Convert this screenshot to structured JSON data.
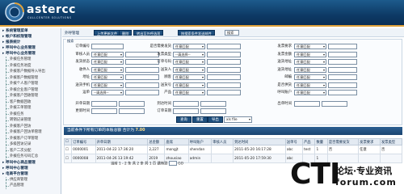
{
  "brand": {
    "name": "astercc",
    "tagline": "CALLCENTER SOLUTIONS"
  },
  "sidebar": {
    "items": [
      {
        "kind": "group",
        "label": "系统管理菜单"
      },
      {
        "kind": "group",
        "label": "帐户和权限管理"
      },
      {
        "kind": "group",
        "label": "报表统计"
      },
      {
        "kind": "group",
        "label": "呼叫中心业务管理"
      },
      {
        "kind": "group",
        "label": "呼叫中心业务管理"
      },
      {
        "kind": "sub",
        "label": "外拨任务管理"
      },
      {
        "kind": "sub",
        "label": "外拨任务进度"
      },
      {
        "kind": "sub",
        "label": "外拨客户数据导入导出"
      },
      {
        "kind": "sub",
        "label": "外拨客户数据管理"
      },
      {
        "kind": "sub",
        "label": "外拨个人客户管理"
      },
      {
        "kind": "sub",
        "label": "外拨企业客户管理"
      },
      {
        "kind": "sub",
        "label": "外拨客户回收管理"
      },
      {
        "kind": "sub",
        "label": "客户数据回收"
      },
      {
        "kind": "sub",
        "label": "外拨工单管理"
      },
      {
        "kind": "sub",
        "label": "外拨任务"
      },
      {
        "kind": "sub",
        "label": "转销记录管理"
      },
      {
        "kind": "sub",
        "label": "外拨客户回访"
      },
      {
        "kind": "sub",
        "label": "外拨客户回访单管理"
      },
      {
        "kind": "sub",
        "label": "外拨客户订单管理"
      },
      {
        "kind": "sub",
        "label": "多级回访记录"
      },
      {
        "kind": "sub",
        "label": "客户二次分配"
      },
      {
        "kind": "sub",
        "label": "外拨任务号码汇总"
      },
      {
        "kind": "group",
        "label": "呼叫中心商品管理"
      },
      {
        "kind": "group",
        "label": "呼叫中心管理"
      },
      {
        "kind": "group",
        "label": "电商平台管理"
      },
      {
        "kind": "sub",
        "label": "供应商管理"
      },
      {
        "kind": "sub",
        "label": "产品管理"
      }
    ]
  },
  "toolbar": {
    "title": "外呼管理",
    "buttons": [
      "上传更新文件",
      "删除",
      "转出至外呼选项",
      "按搜索条件发送邮件"
    ],
    "select_value": "搜索"
  },
  "search": {
    "legend": "搜索",
    "rows": [
      [
        {
          "label": "订单编号",
          "type": "input",
          "value": ""
        },
        {
          "label": "是否需要发货",
          "type": "select",
          "value": "任意匹配"
        },
        {
          "label": "发票要求",
          "type": "select",
          "value": "任意匹配"
        }
      ],
      [
        {
          "label": "审核人员",
          "type": "select",
          "value": "任意匹配"
        },
        {
          "label": "发票类型",
          "type": "select",
          "value": "--请选择--"
        },
        {
          "label": "发票金额",
          "type": "select",
          "value": "任意匹配"
        }
      ],
      [
        {
          "label": "发货状态",
          "type": "select",
          "value": "任意匹配"
        },
        {
          "label": "订单号码",
          "type": "select",
          "value": "任意匹配"
        },
        {
          "label": "送货地址",
          "type": "select",
          "value": "任意匹配"
        }
      ],
      [
        {
          "label": "收件人",
          "type": "select",
          "value": "任意匹配"
        },
        {
          "label": "送货人",
          "type": "select",
          "value": "任意匹配"
        },
        {
          "label": "送货地址",
          "type": "select",
          "value": "任意匹配"
        }
      ],
      [
        {
          "label": "地址",
          "type": "select",
          "value": "任意匹配"
        },
        {
          "label": "顾客",
          "type": "select",
          "value": "任意匹配"
        },
        {
          "label": "邮编",
          "type": "select",
          "value": "任意匹配"
        }
      ],
      [
        {
          "label": "送货手机",
          "type": "select",
          "value": "任意匹配"
        },
        {
          "label": "送货号",
          "type": "select",
          "value": "任意匹配"
        },
        {
          "label": "是否供货",
          "type": "select",
          "value": "任意匹配"
        }
      ],
      [
        {
          "label": "运单",
          "type": "select",
          "value": "--请选择--"
        },
        {
          "label": "产品",
          "type": "select",
          "value": "任意匹配"
        },
        {
          "label": "呼叫账户",
          "type": "select",
          "value": "任意匹配"
        }
      ]
    ],
    "date_rows": [
      [
        {
          "label": "开单日期"
        },
        {
          "label": "到达时间"
        },
        {
          "label": "出单时间"
        }
      ],
      [
        {
          "label": "更新时间"
        },
        {
          "label": "订单日期"
        },
        {
          "label": ""
        }
      ]
    ],
    "actions": [
      "查询",
      "重置",
      "导出"
    ],
    "export_select": "xls file"
  },
  "summary": {
    "prefix": "当前条件下所有订单的本账总额",
    "total_label": "合计为",
    "total_value": "7.00"
  },
  "grid": {
    "headers": [
      "",
      "订单编号",
      "开单日期",
      "总金额",
      "座席",
      "呼叫账户",
      "审核人员",
      "到达时间",
      "送单号",
      "产品",
      "数量",
      "是否需要发货",
      "发票要求",
      "发票类型"
    ],
    "rows": [
      [
        "",
        "0000001",
        "2011-04-22 17:36:20",
        "2,227",
        "mongjt",
        "shendan",
        "",
        "2011-05-20 16:17:28",
        "abc",
        "test",
        "1",
        "否",
        "任意",
        "否"
      ],
      [
        "",
        "0000008",
        "2011-04-26 13:19:42",
        "2019",
        "zhousiao",
        "admin",
        "",
        "2011-05-20 17:59:30",
        "abc",
        "",
        "1",
        "",
        "",
        ""
      ]
    ]
  },
  "pager": {
    "text": "当前 1 - 2 条 共 2 条 共 1 页 跳转到",
    "go": "GO"
  },
  "watermark": {
    "brand": "CTI",
    "slogan": "论坛·专业资讯",
    "domain": "forum.com"
  }
}
